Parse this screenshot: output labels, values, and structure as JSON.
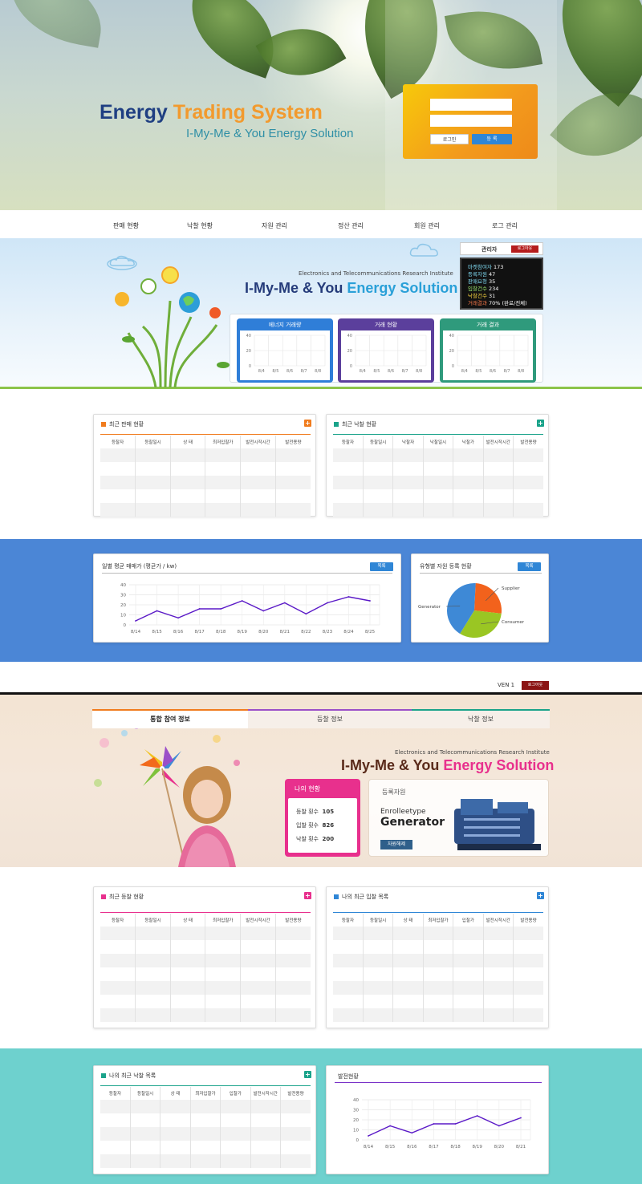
{
  "hero": {
    "title_main": "Energy",
    "title_highlight": "Trading System",
    "subtitle": "I-My-Me & You Energy Solution",
    "login": {
      "login_label": "로그인",
      "register_label": "등 록"
    }
  },
  "nav": {
    "items": [
      "판매 현황",
      "낙찰 현황",
      "자원 관리",
      "정산 관리",
      "회원 관리",
      "로그 관리"
    ]
  },
  "band1": {
    "etri": "Electronics and Telecommunications Research Institute",
    "title_a": "I-My-Me & You",
    "title_b": "Energy Solution",
    "status": {
      "admin_label": "관리자",
      "logout_label": "로그아웃",
      "rows": [
        {
          "k": "마켓참여자",
          "v": "173",
          "color": "#7fd9f0"
        },
        {
          "k": "등록자원",
          "v": "47",
          "color": "#7fd9f0"
        },
        {
          "k": "판매요청",
          "v": "35",
          "color": "#7fd9f0"
        },
        {
          "k": "입찰건수",
          "v": "234",
          "color": "#9be36c"
        },
        {
          "k": "낙찰건수",
          "v": "31",
          "color": "#f7d440"
        },
        {
          "k": "거래결과",
          "v": "70% (완료/전체)",
          "color": "#ff7b4a"
        }
      ]
    },
    "mini_panels": [
      {
        "title": "에너지 거래량",
        "color": "#2f7ed8"
      },
      {
        "title": "거래 현황",
        "color": "#5b3f9c"
      },
      {
        "title": "거래 결과",
        "color": "#2f9a7c"
      }
    ],
    "mini_axis": {
      "y": [
        "40",
        "20",
        "0"
      ],
      "x": [
        "8/4",
        "8/5",
        "8/6",
        "8/7",
        "8/8"
      ]
    }
  },
  "tables1": {
    "left": {
      "title": "최근 판매 현황",
      "accent": "#f07c1e",
      "headers": [
        "등찰자",
        "등찰일시",
        "상 태",
        "최저입찰가",
        "발전시작시간",
        "발전용량"
      ]
    },
    "right": {
      "title": "최근 낙찰 현황",
      "accent": "#1aa38a",
      "headers": [
        "등찰자",
        "등찰일시",
        "낙찰자",
        "낙찰일시",
        "낙찰가",
        "발전시작시간",
        "발전용량"
      ]
    }
  },
  "band2": {
    "line_card": {
      "title": "일별 평균 매매가 (평균가 / kw)",
      "button": "목록"
    },
    "pie_card": {
      "title": "유형별 자원 등록 현황",
      "button": "목록"
    }
  },
  "chart_data": [
    {
      "type": "line",
      "title": "일별 평균 매매가 (평균가 / kw)",
      "x": [
        "8/14",
        "8/15",
        "8/16",
        "8/17",
        "8/18",
        "8/19",
        "8/20",
        "8/21",
        "8/22",
        "8/23",
        "8/24",
        "8/25"
      ],
      "series": [
        {
          "values": [
            4,
            14,
            7,
            16,
            16,
            24,
            14,
            22,
            11,
            22,
            28,
            24
          ]
        }
      ],
      "yticks": [
        "40",
        "30",
        "20",
        "10",
        "0"
      ],
      "ylim": [
        0,
        40
      ],
      "color": "#5a19c7",
      "grid": true
    },
    {
      "type": "pie",
      "title": "유형별 자원 등록 현황",
      "slices": [
        {
          "label": "Supplier",
          "value": 26,
          "color": "#f2621c"
        },
        {
          "label": "Consumer",
          "value": 32,
          "color": "#9ac623"
        },
        {
          "label": "Generator",
          "value": 42,
          "color": "#3e89d6"
        }
      ]
    },
    {
      "type": "line",
      "title": "발전현황",
      "x": [
        "8/14",
        "8/15",
        "8/16",
        "8/17",
        "8/18",
        "8/19",
        "8/20",
        "8/21"
      ],
      "series": [
        {
          "values": [
            4,
            14,
            7,
            16,
            16,
            24,
            14,
            22
          ]
        }
      ],
      "yticks": [
        "40",
        "30",
        "20",
        "10",
        "0"
      ],
      "ylim": [
        0,
        40
      ],
      "color": "#5a19c7",
      "grid": true
    }
  ],
  "user_bar": {
    "name": "VEN 1",
    "logout_label": "로그아웃"
  },
  "tabs": [
    "통합 참여 정보",
    "등찰 정보",
    "낙찰 정보"
  ],
  "band3": {
    "etri": "Electronics and Telecommunications Research Institute",
    "title_a": "I-My-Me & You",
    "title_b": "Energy Solution",
    "my_status": {
      "title": "나의 현황",
      "rows": [
        {
          "k": "등찰 횟수",
          "v": "105"
        },
        {
          "k": "입찰 횟수",
          "v": "826"
        },
        {
          "k": "낙찰 횟수",
          "v": "200"
        }
      ]
    },
    "registered": {
      "title": "등록자원",
      "type_label": "Enrolleetype",
      "type_value": "Generator",
      "button": "자원해제"
    }
  },
  "tables2": {
    "left": {
      "title": "최근 등찰 현황",
      "accent": "#e8308d",
      "headers": [
        "등찰자",
        "등찰일시",
        "상 태",
        "최저입찰가",
        "발전시작시간",
        "발전용량"
      ]
    },
    "right": {
      "title": "나의 최근 입찰 목록",
      "accent": "#2f86d6",
      "headers": [
        "등찰자",
        "등찰일시",
        "상 태",
        "최저입찰가",
        "입찰가",
        "발전시작시간",
        "발전용량"
      ]
    }
  },
  "band4": {
    "table": {
      "title": "나의 최근 낙찰 목록",
      "accent": "#1aa38a",
      "headers": [
        "등찰자",
        "등찰일시",
        "상 태",
        "최저입찰가",
        "입찰가",
        "발전시작시간",
        "발전용량"
      ]
    },
    "chart_title": "발전현황"
  }
}
